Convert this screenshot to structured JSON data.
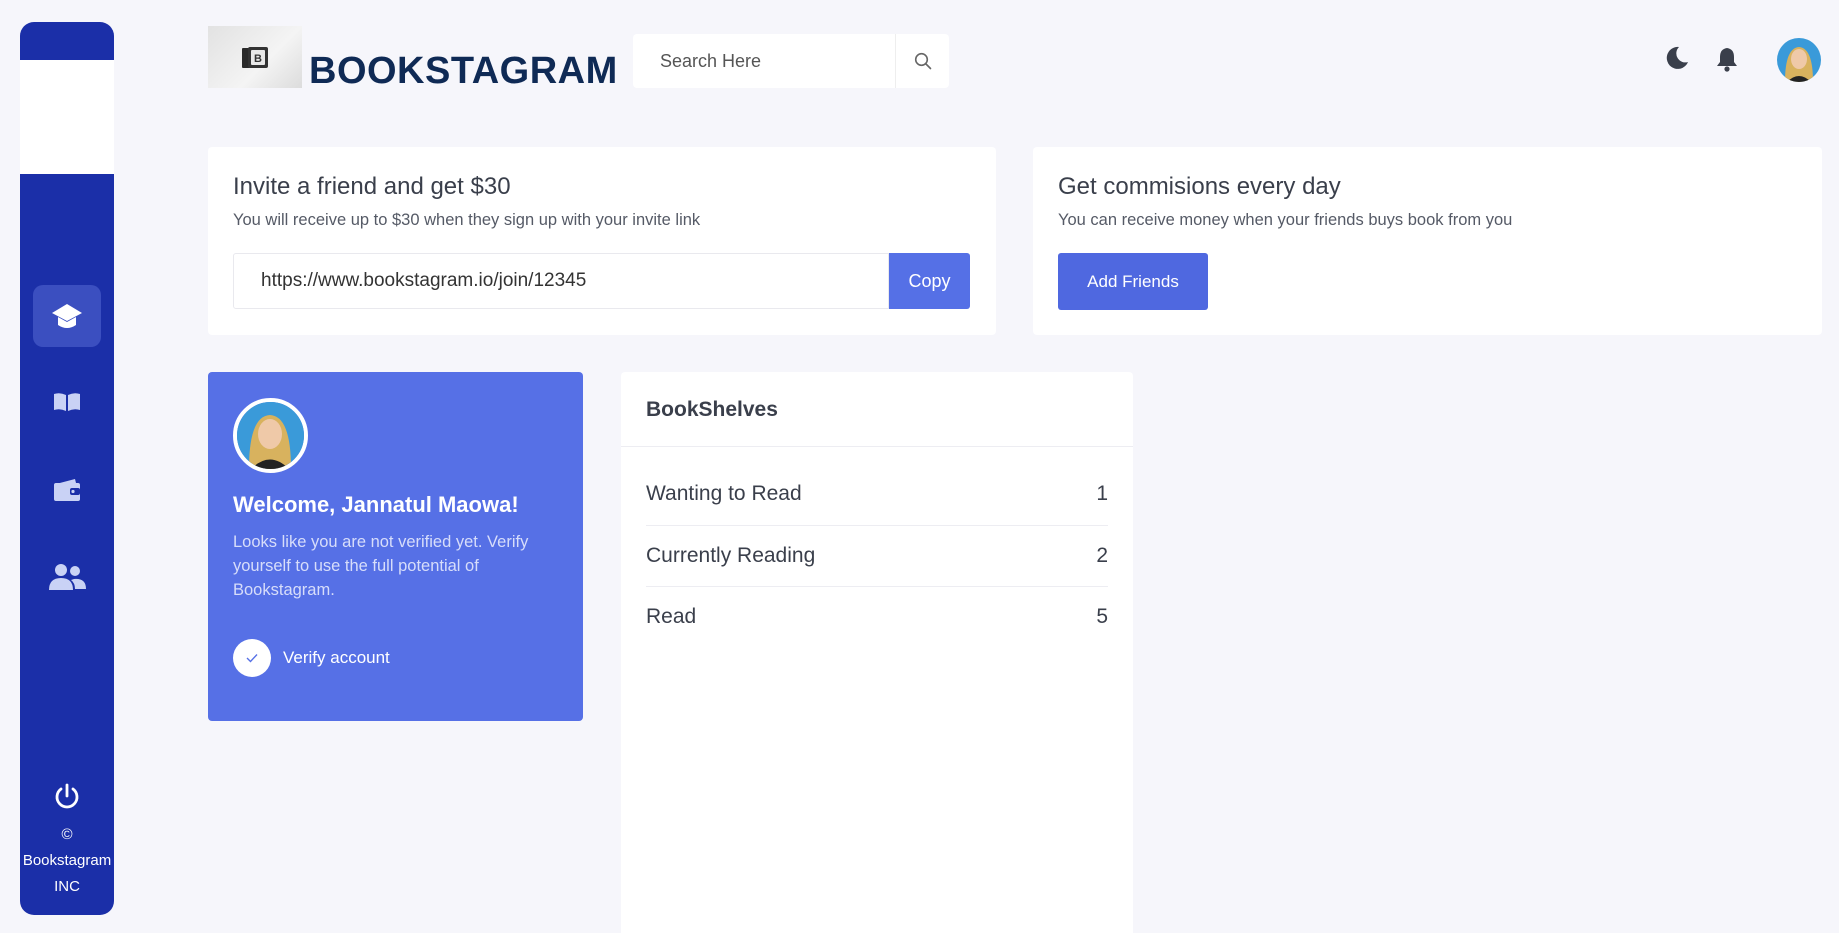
{
  "sidebar": {
    "nav": [
      {
        "icon": "home-icon",
        "active": true
      },
      {
        "icon": "book-icon",
        "active": false
      },
      {
        "icon": "wallet-icon",
        "active": false
      },
      {
        "icon": "users-icon",
        "active": false
      }
    ],
    "copyright_symbol": "©",
    "copyright_name": "Bookstagram",
    "copyright_suffix": "INC"
  },
  "header": {
    "brand": "BOOKSTAGRAM",
    "search_placeholder": "Search Here"
  },
  "invite": {
    "title": "Invite a friend and get $30",
    "subtitle": "You will receive up to $30 when they sign up with your invite link",
    "link": "https://www.bookstagram.io/join/12345",
    "copy_label": "Copy"
  },
  "commissions": {
    "title": "Get commisions every day",
    "subtitle": "You can receive money when your friends buys book from you",
    "button_label": "Add Friends"
  },
  "welcome": {
    "title": "Welcome, Jannatul Maowa!",
    "text": "Looks like you are not verified yet. Verify yourself to use the full potential of Bookstagram.",
    "verify_label": "Verify account"
  },
  "bookshelves": {
    "title": "BookShelves",
    "rows": [
      {
        "label": "Wanting to Read",
        "count": "1"
      },
      {
        "label": "Currently Reading",
        "count": "2"
      },
      {
        "label": "Read",
        "count": "5"
      }
    ]
  },
  "colors": {
    "sidebar": "#1b2fa8",
    "accent": "#5570e6",
    "brand_text": "#0f2a55",
    "background": "#f6f6fb"
  }
}
